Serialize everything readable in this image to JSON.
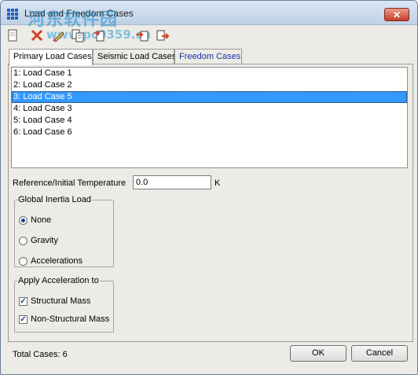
{
  "window": {
    "title": "Load and Freedom Cases",
    "close_label": "✕"
  },
  "watermark": {
    "line1": "河东软件园",
    "line2": "www.pc0359.cn"
  },
  "toolbar": {
    "buttons": [
      {
        "icon": "new-icon"
      },
      {
        "icon": "delete-icon"
      },
      {
        "icon": "edit-icon"
      },
      {
        "icon": "copy-icon"
      },
      {
        "icon": "rename-icon"
      },
      {
        "icon": "import-icon"
      },
      {
        "icon": "export-icon"
      }
    ]
  },
  "tabs": [
    {
      "label": "Primary Load Cases"
    },
    {
      "label": "Seismic Load Cases"
    },
    {
      "label": "Freedom Cases"
    }
  ],
  "load_cases": [
    "1: Load Case 1",
    "2: Load Case 2",
    "3: Load Case 5",
    "4: Load Case 3",
    "5: Load Case 4",
    "6: Load Case 6"
  ],
  "selected_index": 2,
  "reference": {
    "label": "Reference/Initial Temperature",
    "value": "0.0",
    "unit": "K"
  },
  "global_inertia": {
    "title": "Global Inertia Load",
    "options": [
      "None",
      "Gravity",
      "Accelerations"
    ],
    "selected": "None"
  },
  "apply_acceleration": {
    "title": "Apply Acceleration to",
    "options": [
      {
        "label": "Structural Mass",
        "checked": true
      },
      {
        "label": "Non-Structural Mass",
        "checked": true
      }
    ]
  },
  "status": {
    "total_cases": "Total Cases: 6"
  },
  "buttons": {
    "ok": "OK",
    "cancel": "Cancel"
  },
  "colors": {
    "selection": "#3399ff",
    "link_tab": "#1a34a8"
  }
}
